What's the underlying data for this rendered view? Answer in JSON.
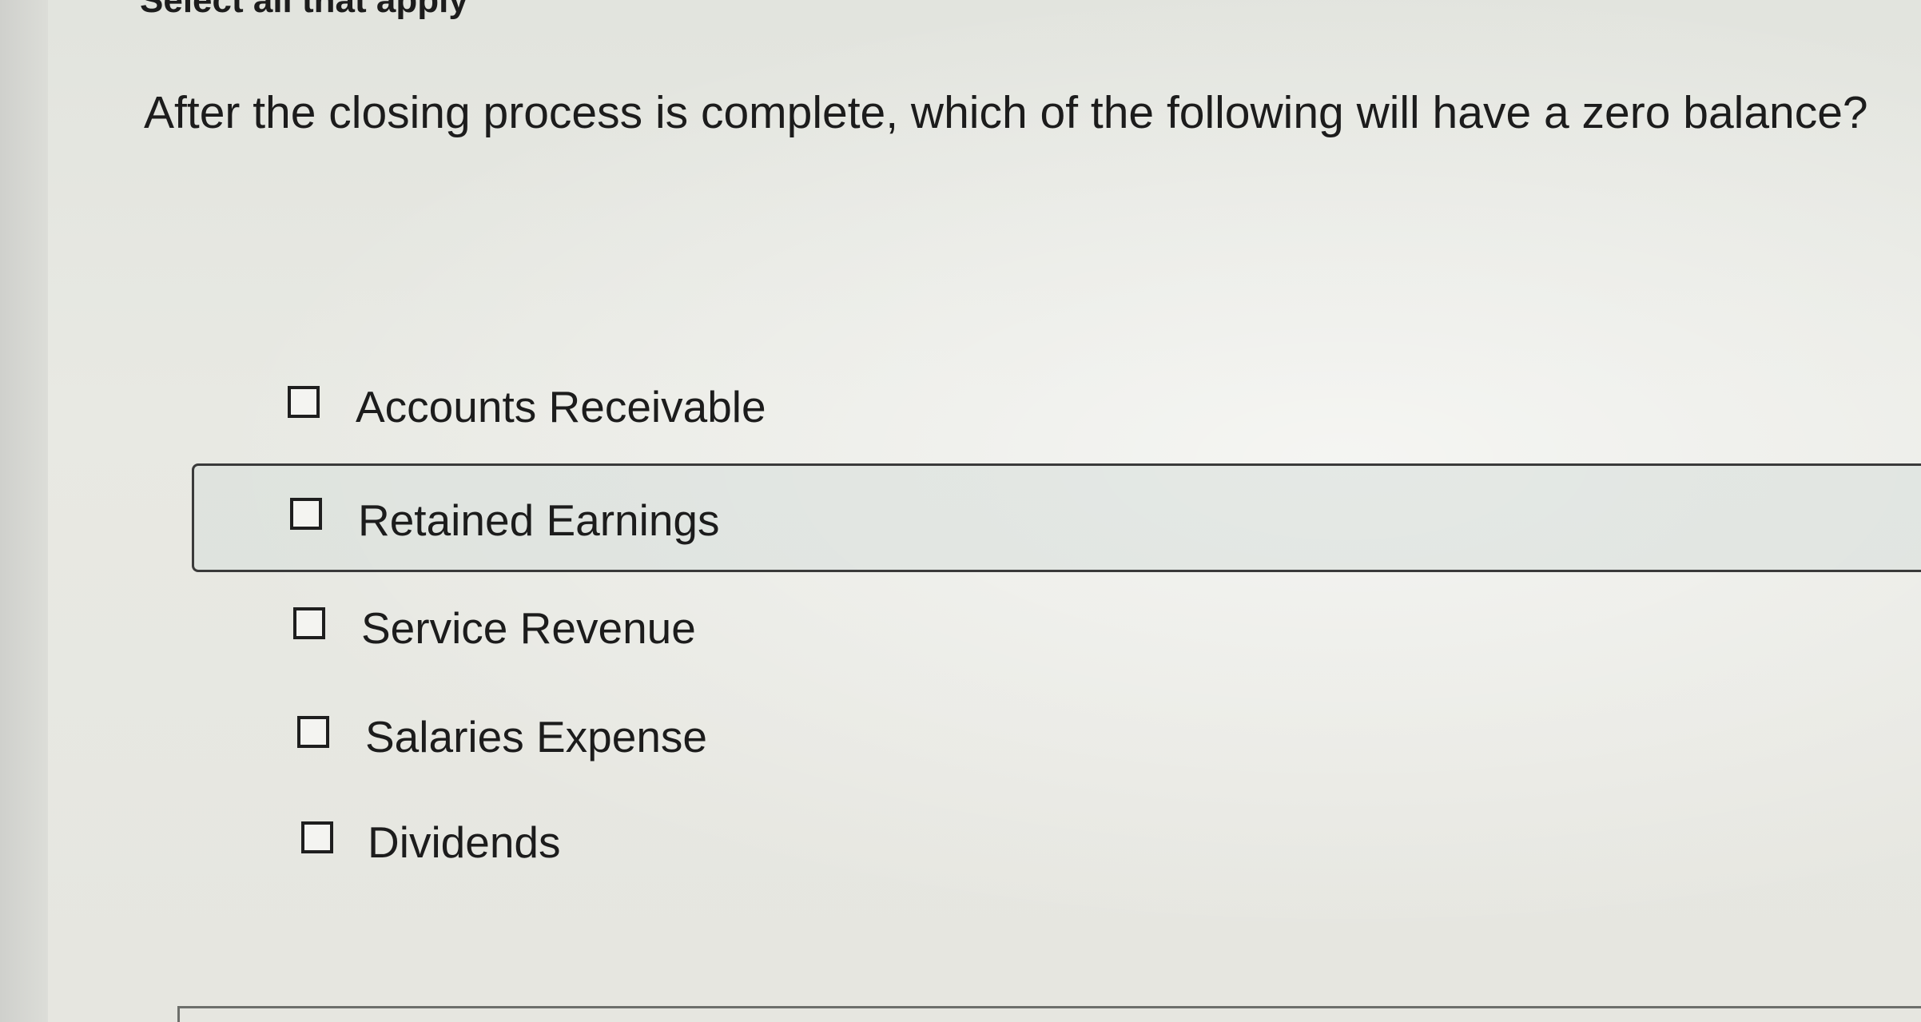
{
  "instruction": "Select all that apply",
  "question": "After the closing process is complete, which of the following will have a zero balance?",
  "options": [
    {
      "label": "Accounts Receivable",
      "checked": false
    },
    {
      "label": "Retained Earnings",
      "checked": false,
      "highlighted": true
    },
    {
      "label": "Service Revenue",
      "checked": false
    },
    {
      "label": "Salaries Expense",
      "checked": false
    },
    {
      "label": "Dividends",
      "checked": false
    }
  ]
}
